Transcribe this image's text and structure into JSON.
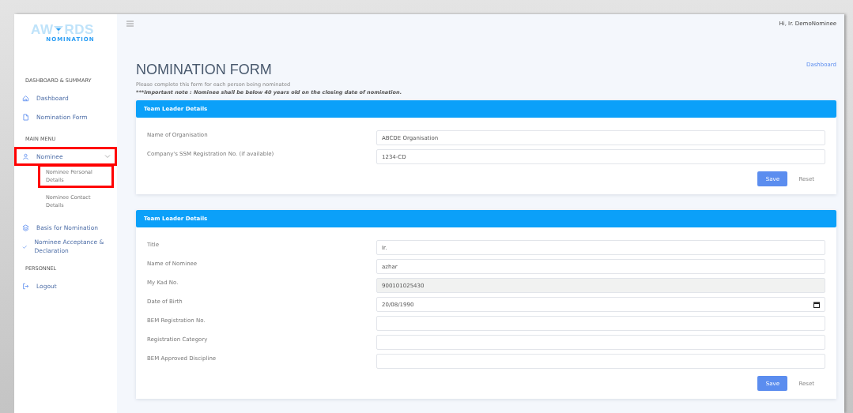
{
  "logo": {
    "before": "AW",
    "after": "RDS",
    "tagline": "NOMINATION"
  },
  "sidebar": {
    "sections": [
      {
        "title": "DASHBOARD & SUMMARY",
        "items": [
          {
            "label": "Dashboard",
            "highlighted": false
          },
          {
            "label": "Nomination Form",
            "highlighted": false
          }
        ]
      },
      {
        "title": "MAIN MENU",
        "items": [
          {
            "label": "Nominee",
            "expanded": true,
            "highlighted": true,
            "children": [
              {
                "label": "Nominee Personal Details",
                "highlighted": true
              },
              {
                "label": "Nominee Contact Details",
                "highlighted": false
              }
            ]
          },
          {
            "label": "Basis for Nomination",
            "highlighted": false
          },
          {
            "label": "Nominee Acceptance & Declaration",
            "highlighted": false
          }
        ]
      },
      {
        "title": "PERSONNEL",
        "items": [
          {
            "label": "Logout",
            "highlighted": false
          }
        ]
      }
    ]
  },
  "topbar": {
    "greeting": "Hi, Ir. DemoNominee"
  },
  "page": {
    "title": "NOMINATION FORM",
    "breadcrumb": "Dashboard",
    "subtitle": "Please complete this form for each person being nominated",
    "note": "***Important note : Nominee shall be below 40 years old on the closing date of nomination."
  },
  "cards": [
    {
      "header": "Team Leader Details",
      "fields": [
        {
          "label": "Name of Organisation",
          "value": "ABCDE Organisation",
          "kind": "text",
          "disabled": false
        },
        {
          "label": "Company's SSM Registration No. (if available)",
          "value": "1234-CD",
          "kind": "text",
          "disabled": false
        }
      ],
      "buttons": {
        "save": "Save",
        "reset": "Reset"
      }
    },
    {
      "header": "Team Leader Details",
      "fields": [
        {
          "label": "Title",
          "value": "Ir.",
          "kind": "text",
          "disabled": false
        },
        {
          "label": "Name of Nominee",
          "value": "azhar",
          "kind": "text",
          "disabled": false
        },
        {
          "label": "My Kad No.",
          "value": "900101025430",
          "kind": "text",
          "disabled": true
        },
        {
          "label": "Date of Birth",
          "value": "20/08/1990",
          "kind": "date",
          "disabled": false
        },
        {
          "label": "BEM Registration No.",
          "kind": "text",
          "disabled": false
        },
        {
          "label": "Registration Category",
          "kind": "text",
          "disabled": false
        },
        {
          "label": "BEM Approved Discipline",
          "kind": "text",
          "disabled": false
        }
      ],
      "buttons": {
        "save": "Save",
        "reset": "Reset"
      }
    }
  ]
}
